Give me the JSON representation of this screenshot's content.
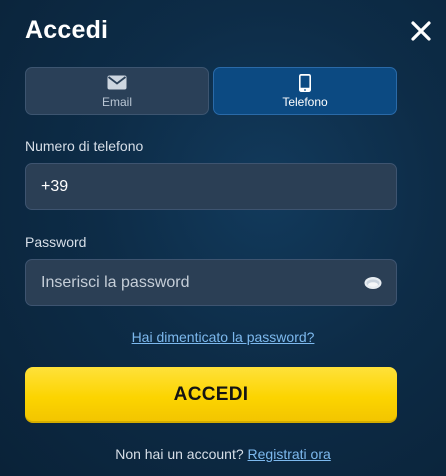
{
  "dialog": {
    "title": "Accedi",
    "close_icon": "close-icon"
  },
  "tabs": [
    {
      "label": "Email",
      "icon": "mail-icon",
      "selected": false
    },
    {
      "label": "Telefono",
      "icon": "smartphone-icon",
      "selected": true
    }
  ],
  "phone": {
    "label": "Numero di telefono",
    "value": "+39"
  },
  "password": {
    "label": "Password",
    "placeholder": "Inserisci la password",
    "toggle_icon": "eye-icon"
  },
  "forgot_link": "Hai dimenticato la password?",
  "submit_label": "ACCEDI",
  "footer": {
    "text": "Non hai un account?",
    "link": "Registrati ora"
  },
  "colors": {
    "background": "#0d2c47",
    "accent_button": "#fcd400",
    "selected_tab": "#0c4a82",
    "link": "#7db9ee"
  }
}
